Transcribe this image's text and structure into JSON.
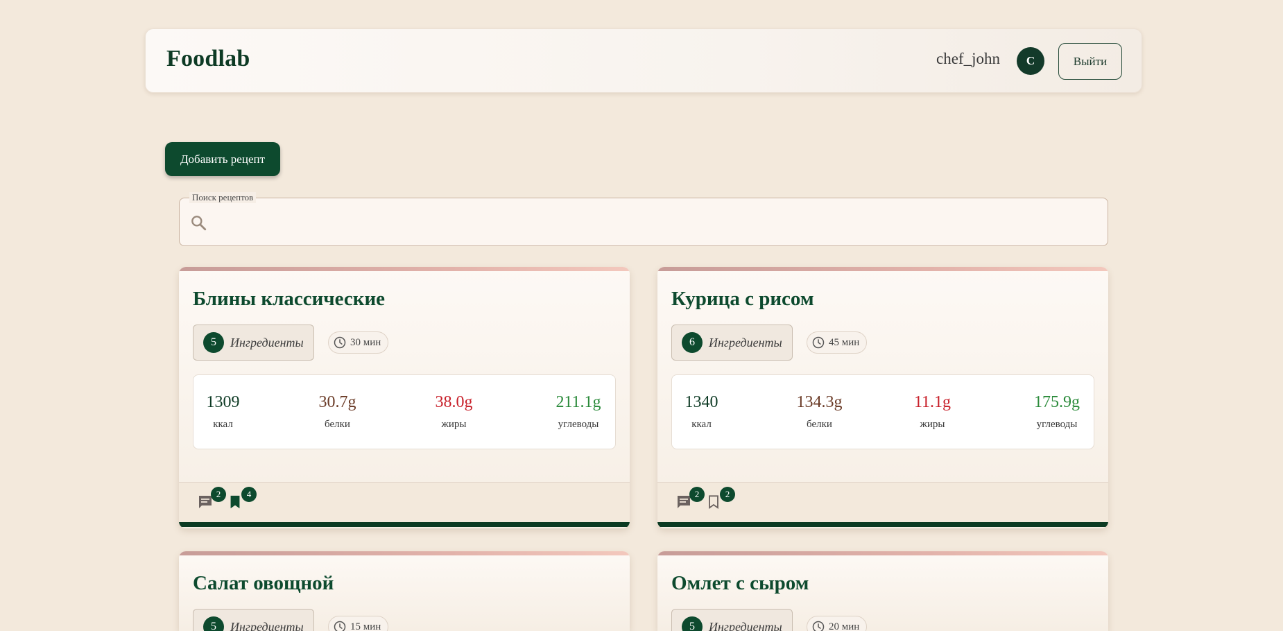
{
  "header": {
    "brand": "Foodlab",
    "username": "chef_john",
    "avatar_letter": "C",
    "logout_label": "Выйти"
  },
  "toolbar": {
    "add_recipe_label": "Добавить рецепт"
  },
  "search": {
    "legend": "Поиск рецептов",
    "value": "",
    "icon": "search-icon"
  },
  "labels": {
    "ingredients": "Ингредиенты",
    "kcal": "ккал",
    "protein": "белки",
    "fat": "жиры",
    "carbs": "углеводы"
  },
  "colors": {
    "brand_green": "#0d4a2e",
    "fat_red": "#c8202a",
    "carbs_green": "#2a8a3a",
    "protein_brown": "#6a3a26"
  },
  "recipes": [
    {
      "title": "Блины классические",
      "ingredients_count": "5",
      "time": "30 мин",
      "kcal": "1309",
      "protein": "30.7g",
      "fat": "38.0g",
      "carbs": "211.1g",
      "comments": "2",
      "bookmarks": "4",
      "bookmarked": true
    },
    {
      "title": "Курица с рисом",
      "ingredients_count": "6",
      "time": "45 мин",
      "kcal": "1340",
      "protein": "134.3g",
      "fat": "11.1g",
      "carbs": "175.9g",
      "comments": "2",
      "bookmarks": "2",
      "bookmarked": false
    },
    {
      "title": "Салат овощной",
      "ingredients_count": "5",
      "time": "15 мин"
    },
    {
      "title": "Омлет с сыром",
      "ingredients_count": "5",
      "time": "20 мин"
    }
  ]
}
